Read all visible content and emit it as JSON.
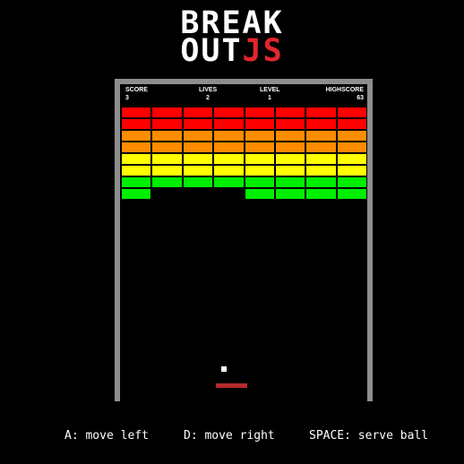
{
  "logo": {
    "line1": "BREAK",
    "line2_white": "OUT",
    "line2_accent": "JS",
    "accent_color": "#e3262d"
  },
  "hud": {
    "score_label": "SCORE",
    "score_value": "3",
    "lives_label": "LIVES",
    "lives_value": "2",
    "level_label": "LEVEL",
    "level_value": "1",
    "highscore_label": "HIGHSCORE",
    "highscore_value": "63"
  },
  "bricks": {
    "columns": 8,
    "row_colors": [
      "#ff0000",
      "#ff0000",
      "#ff8c00",
      "#ff8c00",
      "#ffff00",
      "#ffff00",
      "#00ee00",
      "#00ee00"
    ],
    "present": [
      [
        1,
        1,
        1,
        1,
        1,
        1,
        1,
        1
      ],
      [
        1,
        1,
        1,
        1,
        1,
        1,
        1,
        1
      ],
      [
        1,
        1,
        1,
        1,
        1,
        1,
        1,
        1
      ],
      [
        1,
        1,
        1,
        1,
        1,
        1,
        1,
        1
      ],
      [
        1,
        1,
        1,
        1,
        1,
        1,
        1,
        1
      ],
      [
        1,
        1,
        1,
        1,
        1,
        1,
        1,
        1
      ],
      [
        1,
        1,
        1,
        1,
        1,
        1,
        1,
        1
      ],
      [
        1,
        0,
        0,
        0,
        1,
        1,
        1,
        1
      ]
    ]
  },
  "colors": {
    "wall": "#8e8e8e",
    "paddle": "#b52a2a",
    "ball": "#ffffff",
    "background": "#000000"
  },
  "hints": {
    "left": "A: move left",
    "right": "D: move right",
    "serve": "SPACE: serve ball"
  }
}
